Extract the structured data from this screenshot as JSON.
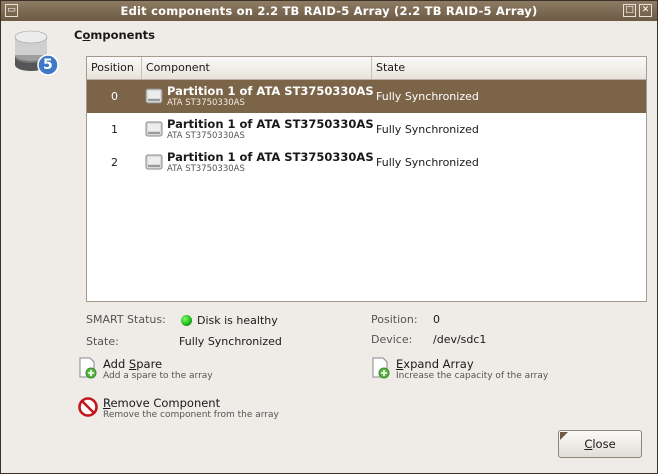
{
  "window": {
    "title": "Edit components on 2.2 TB RAID-5 Array (2.2 TB RAID-5 Array)",
    "menu_glyph": "▭",
    "max_glyph": "□",
    "close_glyph": "✕"
  },
  "raid_badge": "5",
  "components_heading": {
    "prefix": "C",
    "underlined": "o",
    "rest": "mponents"
  },
  "table": {
    "headers": {
      "position": "Position",
      "component": "Component",
      "state": "State"
    },
    "rows": [
      {
        "position": "0",
        "name": "Partition 1 of ATA ST3750330AS",
        "sub": "ATA ST3750330AS",
        "state": "Fully Synchronized",
        "selected": true
      },
      {
        "position": "1",
        "name": "Partition 1 of ATA ST3750330AS",
        "sub": "ATA ST3750330AS",
        "state": "Fully Synchronized",
        "selected": false
      },
      {
        "position": "2",
        "name": "Partition 1 of ATA ST3750330AS",
        "sub": "ATA ST3750330AS",
        "state": "Fully Synchronized",
        "selected": false
      }
    ]
  },
  "details": {
    "smart_label": "SMART Status:",
    "smart_value": "Disk is healthy",
    "state_label": "State:",
    "state_value": "Fully Synchronized",
    "position_label": "Position:",
    "position_value": "0",
    "device_label": "Device:",
    "device_value": "/dev/sdc1"
  },
  "actions": {
    "add_spare": {
      "label_prefix": "Add ",
      "label_mnemonic": "S",
      "label_rest": "pare",
      "desc": "Add a spare to the array"
    },
    "expand": {
      "label_prefix": "",
      "label_mnemonic": "E",
      "label_rest": "xpand Array",
      "desc": "Increase the capacity of the array"
    },
    "remove": {
      "label_prefix": "",
      "label_mnemonic": "R",
      "label_rest": "emove Component",
      "desc": "Remove the component from the array"
    }
  },
  "close_button": {
    "mnemonic": "C",
    "rest": "lose"
  },
  "colors": {
    "accent": "#7b6447",
    "healthy": "#1db01a",
    "remove": "#c4161c"
  }
}
